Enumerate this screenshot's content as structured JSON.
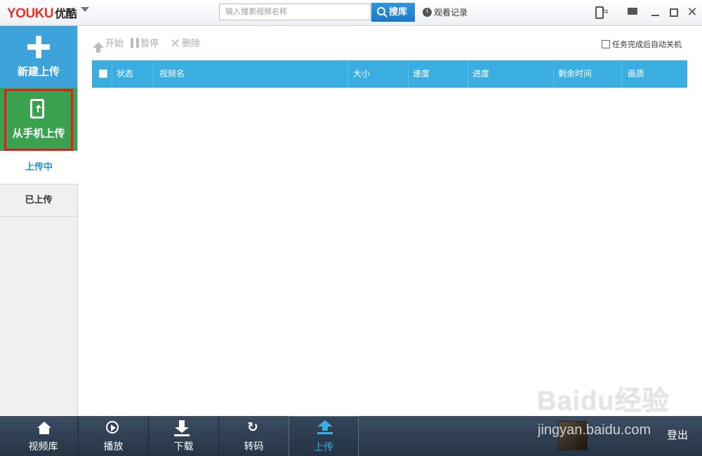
{
  "app": {
    "logo_latin": "YOUKU",
    "logo_cn": "优酷"
  },
  "search": {
    "placeholder": "输入搜索视频名称",
    "button_label": "搜库"
  },
  "history_label": "观看记录",
  "sidebar": {
    "new_upload_label": "新建上传",
    "phone_upload_label": "从手机上传",
    "tab_uploading": "上传中",
    "tab_uploaded": "已上传"
  },
  "toolbar": {
    "start_label": "开始",
    "pause_label": "暂停",
    "delete_label": "删除",
    "auto_shutdown_label": "任务完成后自动关机"
  },
  "table": {
    "columns": [
      "状态",
      "视频名",
      "大小",
      "速度",
      "进度",
      "剩余时间",
      "画质"
    ]
  },
  "bottom_nav": {
    "items": [
      "视频库",
      "播放",
      "下载",
      "转码",
      "上传"
    ],
    "active": "上传",
    "logout_label": "登出"
  },
  "watermark": {
    "brand": "Baidu经验",
    "url": "jingyan.baidu.com"
  },
  "colors": {
    "accent_blue": "#3aaee0",
    "sidebar_blue": "#3da3db",
    "phone_green": "#3aa14f",
    "highlight_red": "#e01d1d",
    "bottom_bar": "#2d3c4f"
  }
}
